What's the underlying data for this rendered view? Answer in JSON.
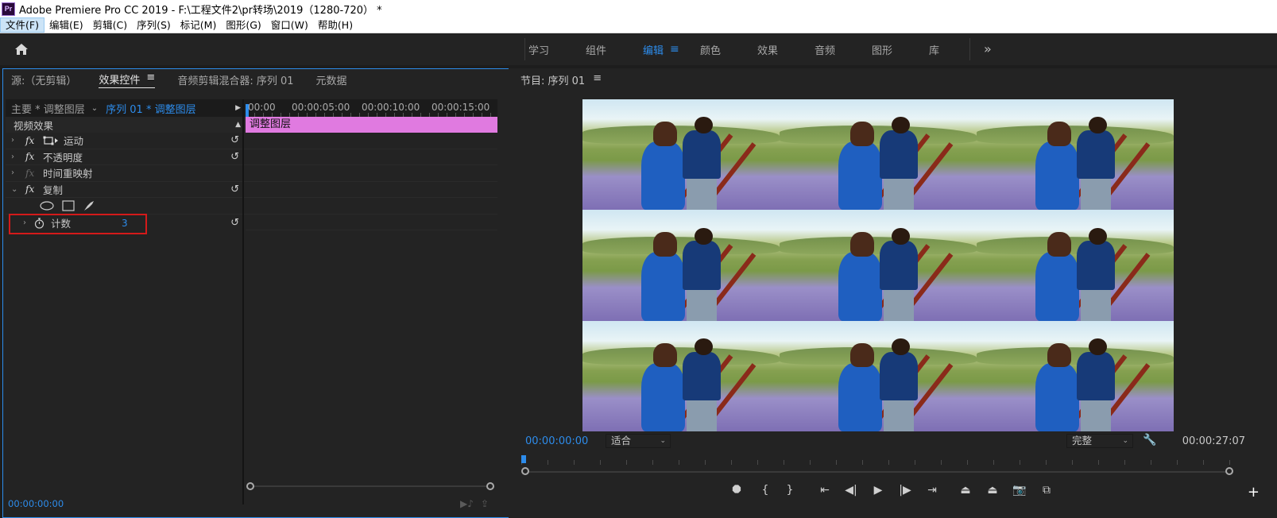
{
  "titlebar": {
    "logo": "Pr",
    "title": "Adobe Premiere Pro CC 2019 - F:\\工程文件2\\pr转场\\2019（1280-720） *"
  },
  "menu": [
    "文件(F)",
    "编辑(E)",
    "剪辑(C)",
    "序列(S)",
    "标记(M)",
    "图形(G)",
    "窗口(W)",
    "帮助(H)"
  ],
  "workspace": {
    "tabs": [
      "学习",
      "组件",
      "编辑",
      "颜色",
      "效果",
      "音频",
      "图形",
      "库"
    ],
    "active": "编辑",
    "more": "»"
  },
  "left_panel": {
    "tabs": [
      "源:（无剪辑）",
      "效果控件",
      "音频剪辑混合器: 序列 01",
      "元数据"
    ],
    "active_tab": "效果控件",
    "clip_name": "主要 * 调整图层",
    "seq_name": "序列 01 * 调整图层",
    "section": "视频效果",
    "effects": [
      {
        "name": "运动",
        "expanded": false,
        "has_motion_icon": true,
        "dim": false
      },
      {
        "name": "不透明度",
        "expanded": false,
        "dim": false
      },
      {
        "name": "时间重映射",
        "expanded": false,
        "dim": true
      },
      {
        "name": "复制",
        "expanded": true,
        "dim": false
      }
    ],
    "count_label": "计数",
    "count_value": "3",
    "timeline": {
      "times": [
        "00:00",
        "00:00:05:00",
        "00:00:10:00",
        "00:00:15:00"
      ],
      "clip": "调整图层"
    },
    "timecode": "00:00:00:00"
  },
  "program": {
    "title": "节目: 序列 01",
    "timecode_left": "00:00:00:00",
    "timecode_right": "00:00:27:07",
    "fit": "适合",
    "quality": "完整"
  },
  "colors": {
    "accent": "#2d8ceb",
    "clip": "#e07ae0",
    "highlight": "#d41a1a"
  }
}
